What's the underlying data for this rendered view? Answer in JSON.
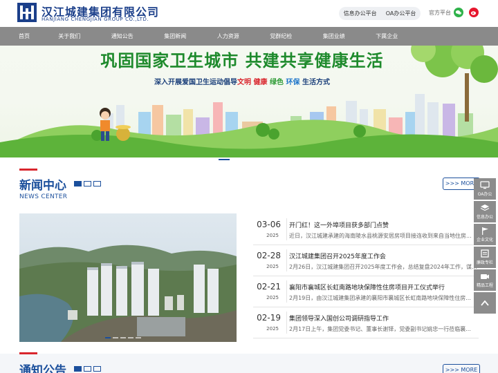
{
  "header": {
    "logo_cn": "汉江城建集团有限公司",
    "logo_en": "HANJIANG CHENGJIAN GROUP CO.,LTD.",
    "links": [
      "信息办公平台",
      "OA办公平台"
    ],
    "official_label": "官方平台",
    "social_icons": [
      "wechat-icon",
      "weibo-icon"
    ]
  },
  "nav": [
    "首页",
    "关于我们",
    "通知公告",
    "集团新闻",
    "人力资源",
    "党群纪检",
    "集团业绩",
    "下属企业"
  ],
  "banner": {
    "title": "巩固国家卫生城市  共建共享健康生活",
    "subtitle_pre": "深入开展爱国卫生运动倡导",
    "subtitle_w1": "文明",
    "subtitle_w2": "健康",
    "subtitle_w3": "绿色",
    "subtitle_w4": "环保",
    "subtitle_post": "生活方式"
  },
  "news": {
    "title": "新闻中心",
    "subtitle": "NEWS CENTER",
    "more": ">>> MORE",
    "items": [
      {
        "date": "03-06",
        "year": "2025",
        "title": "开门红！这一外埠项目获多部门点赞",
        "desc": "近日，汉江城建承建的海南陵水县桃源安居房项目接连收到来自当地住房..."
      },
      {
        "date": "02-28",
        "year": "2025",
        "title": "汉江城建集团召开2025年度工作会",
        "desc": "2月26日，汉江城建集团召开2025年度工作会，总结复盘2024年工作，谋..."
      },
      {
        "date": "02-21",
        "year": "2025",
        "title": "襄阳市襄城区长虹南路地块保障性住房项目开工仪式举行",
        "desc": "2月19日，由汉江城建集团承建的襄阳市襄城区长虹南路地块保障性住房..."
      },
      {
        "date": "02-19",
        "year": "2025",
        "title": "集团领导深入国创公司调研指导工作",
        "desc": "2月17日上午，集团党委书记、董事长谢铎，党委副书记姚忠一行莅临襄..."
      }
    ]
  },
  "notice": {
    "title": "通知公告",
    "more": ">>> MORE"
  },
  "float_bar": [
    {
      "label": "OA办公",
      "icon": "monitor-icon"
    },
    {
      "label": "信息办公",
      "icon": "layers-icon"
    },
    {
      "label": "企业文化",
      "icon": "flag-icon"
    },
    {
      "label": "廉政专栏",
      "icon": "book-icon"
    },
    {
      "label": "精品工程",
      "icon": "video-icon"
    },
    {
      "label": "",
      "icon": "arrow-up-icon"
    }
  ],
  "colors": {
    "brand": "#1b4f9c",
    "accent": "#d9262d",
    "nav_bg": "#8a8a8a",
    "float_bg": "#8c8c8c"
  }
}
